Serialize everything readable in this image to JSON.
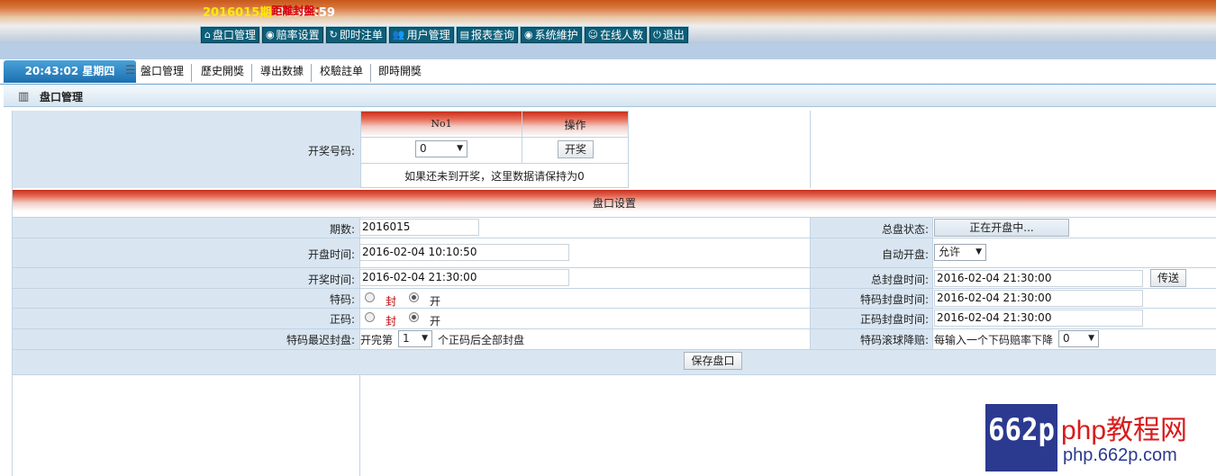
{
  "header": {
    "issue_number": "2016015期",
    "countdown_label": "距離封盤：",
    "countdown_time": "00:46:59",
    "nav": [
      {
        "icon": "home-icon",
        "glyph": "⌂",
        "label": "盘口管理"
      },
      {
        "icon": "settings-icon",
        "glyph": "◉",
        "label": "赔率设置"
      },
      {
        "icon": "refresh-icon",
        "glyph": "↻",
        "label": "即时注单"
      },
      {
        "icon": "users-icon",
        "glyph": "👥",
        "label": "用户管理"
      },
      {
        "icon": "report-icon",
        "glyph": "▤",
        "label": "报表查询"
      },
      {
        "icon": "broadcast-icon",
        "glyph": "◉",
        "label": "系统維护"
      },
      {
        "icon": "online-icon",
        "glyph": "☺",
        "label": "在线人数"
      },
      {
        "icon": "power-icon",
        "glyph": "⏻",
        "label": "退出"
      }
    ]
  },
  "clock": "20:43:02 星期四",
  "subtabs": [
    "盤口管理",
    "歷史開獎",
    "導出数據",
    "校驗註单",
    "即時開獎"
  ],
  "page_title": "盘口管理",
  "draw": {
    "label": "开奖号码:",
    "col1": "No1",
    "col2": "操作",
    "number_value": "0",
    "draw_button": "开奖",
    "hint": "如果还未到开奖，这里数据请保持为0"
  },
  "settings": {
    "section_title": "盘口设置",
    "period_label": "期数:",
    "period_value": "2016015",
    "open_time_label": "开盘时间:",
    "open_time_value": "2016-02-04 10:10:50",
    "draw_time_label": "开奖时间:",
    "draw_time_value": "2016-02-04 21:30:00",
    "special_label": "特码:",
    "normal_label": "正码:",
    "seal_text": "封",
    "open_text": "开",
    "latest_seal_label": "特码最迟封盘:",
    "latest_seal_prefix": "开完第",
    "latest_seal_value": "1",
    "latest_seal_suffix": "个正码后全部封盘",
    "status_label": "总盘状态:",
    "status_button": "正在开盘中...",
    "auto_open_label": "自动开盘:",
    "auto_open_value": "允许",
    "total_seal_label": "总封盘时间:",
    "total_seal_value": "2016-02-04 21:30:00",
    "send_button": "传送",
    "special_seal_label": "特码封盘时间:",
    "special_seal_value": "2016-02-04 21:30:00",
    "normal_seal_label": "正码封盘时间:",
    "normal_seal_value": "2016-02-04 21:30:00",
    "rolling_label": "特码滚球降赔:",
    "rolling_text": "每输入一个下码赔率下降",
    "rolling_value": "0",
    "save_button": "保存盘口"
  },
  "watermark": {
    "logo": "662p",
    "brand": "php教程网",
    "url": "php.662p.com"
  }
}
